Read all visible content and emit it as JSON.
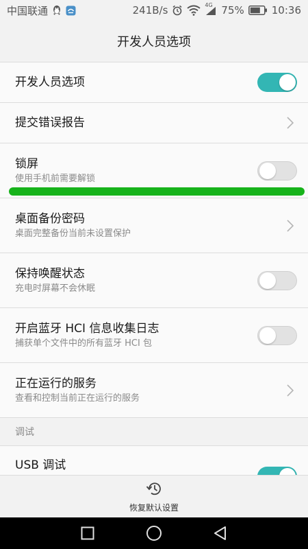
{
  "status_bar": {
    "carrier": "中国联通",
    "net_speed": "241B/s",
    "signal_type": "4G",
    "battery_percent": "75%",
    "time": "10:36",
    "icons": [
      "qq-icon",
      "app-notification-icon",
      "alarm-icon",
      "wifi-icon",
      "signal-icon",
      "battery-icon"
    ]
  },
  "header": {
    "title": "开发人员选项"
  },
  "settings": [
    {
      "title": "开发人员选项",
      "subtitle": "",
      "control": "toggle",
      "state": true
    },
    {
      "title": "提交错误报告",
      "subtitle": "",
      "control": "chevron"
    },
    {
      "title": "锁屏",
      "subtitle": "使用手机前需要解锁",
      "control": "toggle",
      "state": false
    },
    {
      "title": "桌面备份密码",
      "subtitle": "桌面完整备份当前未设置保护",
      "control": "chevron"
    },
    {
      "title": "保持唤醒状态",
      "subtitle": "充电时屏幕不会休眠",
      "control": "toggle",
      "state": false
    },
    {
      "title": "开启蓝牙 HCI 信息收集日志",
      "subtitle": "捕获单个文件中的所有蓝牙 HCI 包",
      "control": "toggle",
      "state": false
    },
    {
      "title": "正在运行的服务",
      "subtitle": "查看和控制当前正在运行的服务",
      "control": "chevron"
    }
  ],
  "debug_section": {
    "header": "调试",
    "usb_debug": {
      "title": "USB 调试",
      "control": "toggle",
      "state": true
    }
  },
  "bottom_action": {
    "label": "恢复默认设置",
    "icon": "restore-history-icon"
  },
  "nav_bar": {
    "buttons": [
      "recent-apps-icon",
      "home-icon",
      "back-icon"
    ]
  },
  "colors": {
    "accent": "#33b6b4",
    "highlight": "#17b31b",
    "background": "#f2f2f2"
  }
}
